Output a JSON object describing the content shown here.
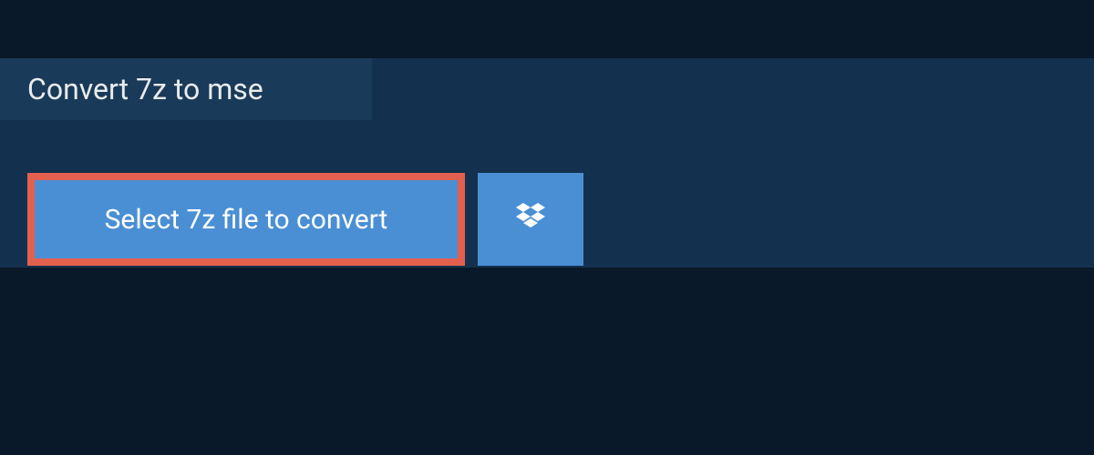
{
  "tab": {
    "title": "Convert 7z to mse"
  },
  "actions": {
    "select_file_label": "Select 7z file to convert"
  },
  "icons": {
    "dropbox": "dropbox-icon"
  }
}
